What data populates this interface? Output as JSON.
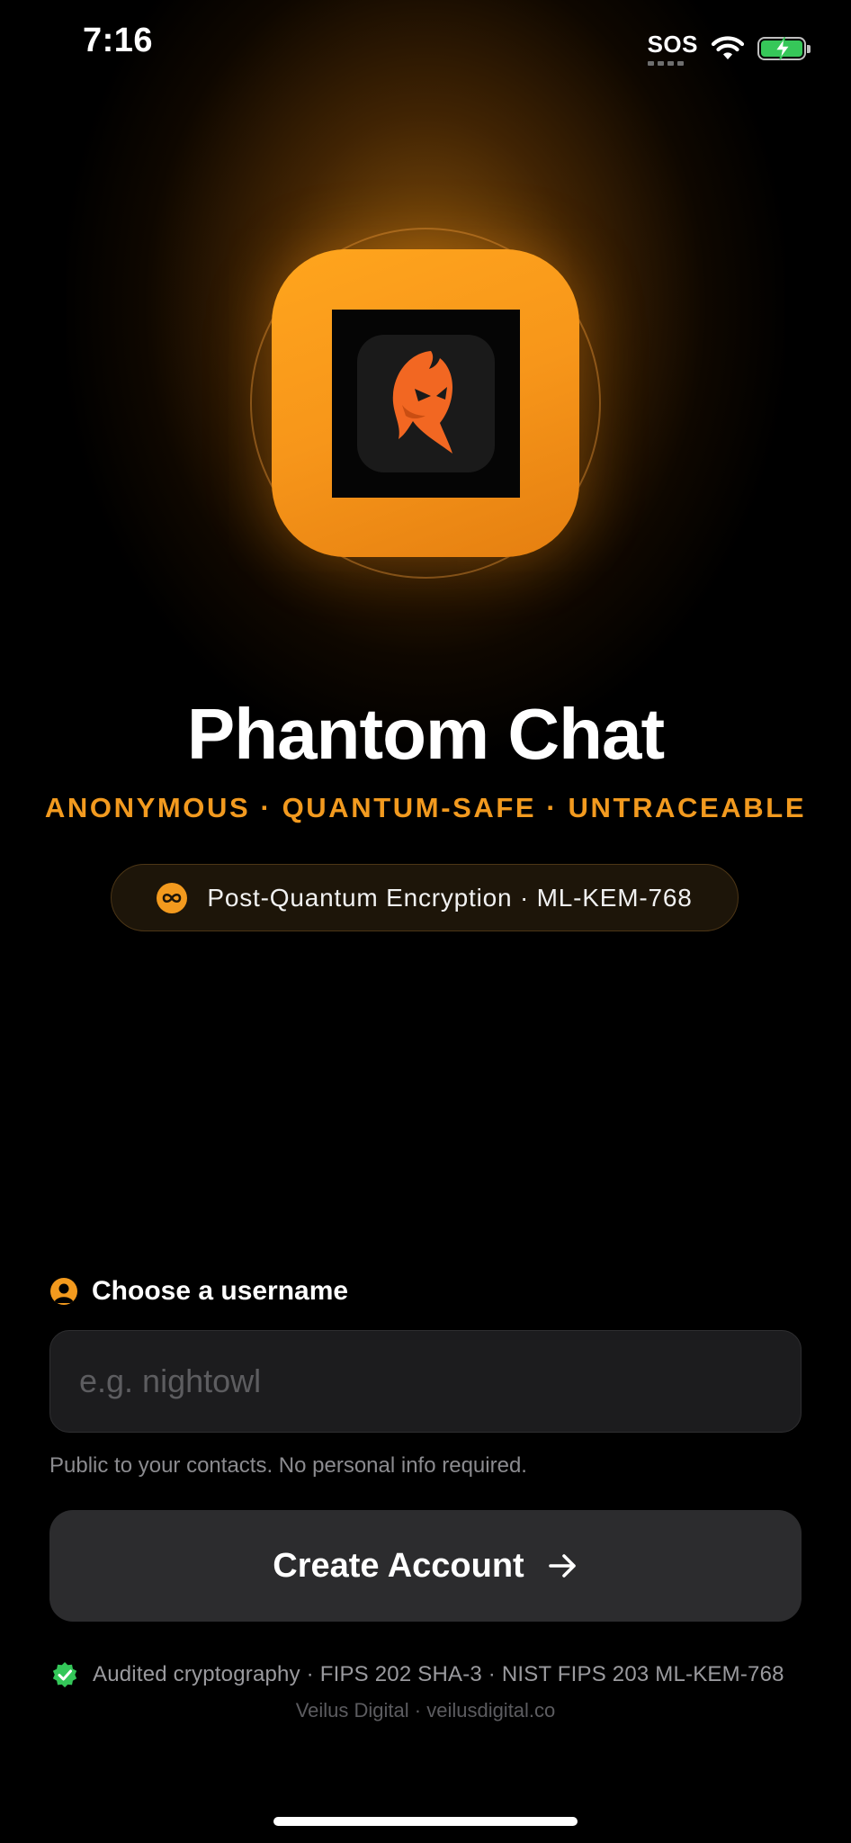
{
  "status_bar": {
    "time": "7:16",
    "sos": "SOS",
    "icons": [
      "wifi-icon",
      "battery-charging-icon"
    ]
  },
  "logo": {
    "icon": "hooded-phantom-icon",
    "colors": {
      "tile": "#f7961a",
      "mascot": "#f26722"
    }
  },
  "header": {
    "title": "Phantom Chat",
    "tagline": "ANONYMOUS · QUANTUM-SAFE · UNTRACEABLE",
    "badge_icon": "infinity-icon",
    "badge_text": "Post-Quantum Encryption · ML-KEM-768"
  },
  "form": {
    "label_icon": "user-circle-icon",
    "label": "Choose a username",
    "username_value": "",
    "placeholder": "e.g. nightowl",
    "helper": "Public to your contacts. No personal info required.",
    "submit_label": "Create Account",
    "submit_icon": "arrow-right-icon"
  },
  "footer": {
    "audit_icon": "verified-check-icon",
    "audit_text": "Audited cryptography · FIPS 202 SHA-3 · NIST FIPS 203 ML-KEM-768",
    "credit": "Veilus Digital · veilusdigital.co"
  },
  "colors": {
    "accent": "#f39a1e",
    "background": "#000000",
    "button": "#2c2c2e",
    "verified": "#34c759"
  }
}
